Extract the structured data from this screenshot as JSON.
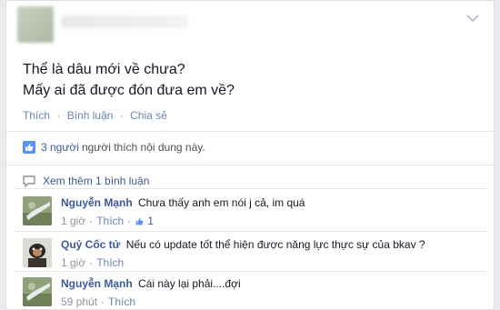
{
  "post": {
    "lines": [
      "Thể là dâu mới về chưa?",
      "Mấy ai đã được đón đưa em về?"
    ],
    "actions": {
      "like": "Thích",
      "comment": "Bình luận",
      "share": "Chia sẻ",
      "separator": "·"
    }
  },
  "likes_summary": {
    "count": "3 người",
    "text": "người thích nội dung này."
  },
  "view_more": "Xem thêm 1 bình luận",
  "comments": [
    {
      "author": "Nguyễn Mạnh",
      "text": "Chưa thấy anh em nói j cả, im quá",
      "time": "1 giờ",
      "like": "Thích",
      "like_count": "1"
    },
    {
      "author": "Quỷ Cốc tử",
      "text": "Nếu có update tốt thể hiện được năng lực thực sự của bkav ?",
      "time": "1 giờ",
      "like": "Thích"
    },
    {
      "author": "Nguyễn Mạnh",
      "text": "Cái này lại phải....đợi",
      "time": "59 phút",
      "like": "Thích"
    }
  ],
  "colors": {
    "link": "#3b5998",
    "muted": "#90949c",
    "background": "#e9ebee"
  },
  "icons": [
    "chevron-down-icon",
    "thumbs-up-icon",
    "comment-bubble-icon"
  ]
}
